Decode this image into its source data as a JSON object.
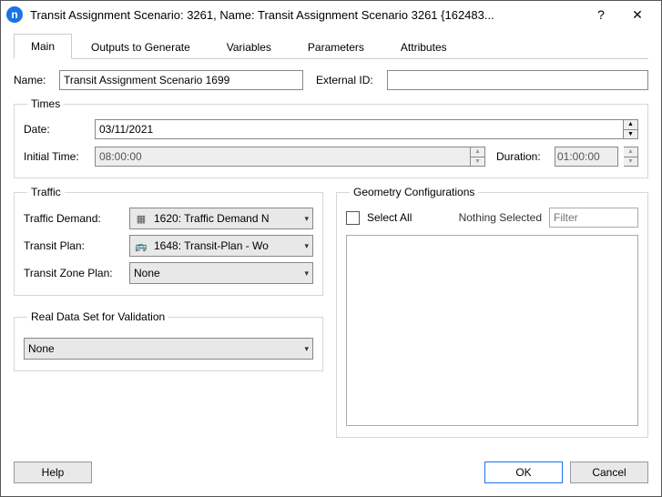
{
  "window": {
    "title": "Transit Assignment Scenario: 3261, Name: Transit Assignment Scenario 3261 {162483..."
  },
  "tabs": {
    "main": "Main",
    "outputs": "Outputs to Generate",
    "variables": "Variables",
    "parameters": "Parameters",
    "attributes": "Attributes"
  },
  "fields": {
    "name_label": "Name:",
    "name_value": "Transit Assignment Scenario 1699",
    "external_id_label": "External ID:",
    "external_id_value": ""
  },
  "times": {
    "legend": "Times",
    "date_label": "Date:",
    "date_value": "03/11/2021",
    "initial_label": "Initial Time:",
    "initial_value": "08:00:00",
    "duration_label": "Duration:",
    "duration_value": "01:00:00"
  },
  "traffic": {
    "legend": "Traffic",
    "demand_label": "Traffic Demand:",
    "demand_value": "1620: Traffic Demand N",
    "plan_label": "Transit Plan:",
    "plan_value": "1648: Transit-Plan - Wo",
    "zone_label": "Transit Zone Plan:",
    "zone_value": "None"
  },
  "real_data": {
    "legend": "Real Data Set for Validation",
    "value": "None"
  },
  "geometry": {
    "legend": "Geometry Configurations",
    "select_all_label": "Select All",
    "status": "Nothing Selected",
    "filter_placeholder": "Filter"
  },
  "buttons": {
    "help": "Help",
    "ok": "OK",
    "cancel": "Cancel"
  },
  "icons": {
    "app_letter": "n"
  }
}
